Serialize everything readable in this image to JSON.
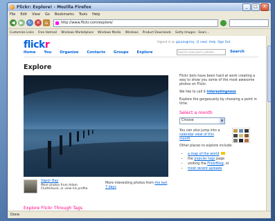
{
  "window": {
    "title": "Flickr: Explore! - Mozilla Firefox",
    "buttons": [
      "_",
      "□",
      "X"
    ]
  },
  "menu": [
    "File",
    "Edit",
    "View",
    "Go",
    "Bookmarks",
    "Tools",
    "Help"
  ],
  "nav": {
    "url": "http://www.flickr.com/explore/"
  },
  "bookmarks": [
    "Customize Links",
    "Free Hotmail",
    "Windows Marketplace",
    "Windows Media",
    "Windows",
    "Product Downloads",
    "Getty Images - Searc..."
  ],
  "flickr": {
    "logo_f": "flick",
    "logo_r": "r",
    "signed_in": "Signed in as",
    "user": "gauravgrimy",
    "inbox": "(2 new)",
    "help": "Help",
    "signout": "Sign Out",
    "nav_items": [
      "Home",
      "You",
      "Organize",
      "Contacts",
      "Groups",
      "Explore"
    ],
    "search_placeholder": "Search everyone's photos",
    "search_label": "Search",
    "heading": "Explore",
    "photo_title": "Vapor Bay",
    "photo_by": "More photos from Adam Clutterbuck, or view his profile.",
    "more_text": "More interesting photos from",
    "more_link": "the last 7 days",
    "tags_heading": "Explore Flickr Through Tags"
  },
  "sidebar": {
    "p1": "Flickr bots have been hard at work creating a way to show you some of the most awesome photos on Flickr.",
    "p2a": "We like to call it",
    "p2b": "interestingness",
    "p3": "Explore the gorgeousity by choosing a point in time.",
    "select_heading": "Select a month",
    "select_value": "Choose",
    "cal_a": "You can also jump into a",
    "cal_link": "calendar view of this month",
    "other_heading": "Other places to explore include:",
    "links": [
      "a map of the world",
      "popular tags",
      "FlickrBlog",
      "most recent uploads"
    ],
    "link_prefix": [
      "",
      "the",
      "visiting the",
      "or"
    ],
    "link_suffix": [
      "",
      "page",
      ", or",
      "."
    ],
    "new_badge": "new"
  },
  "status": "Done"
}
